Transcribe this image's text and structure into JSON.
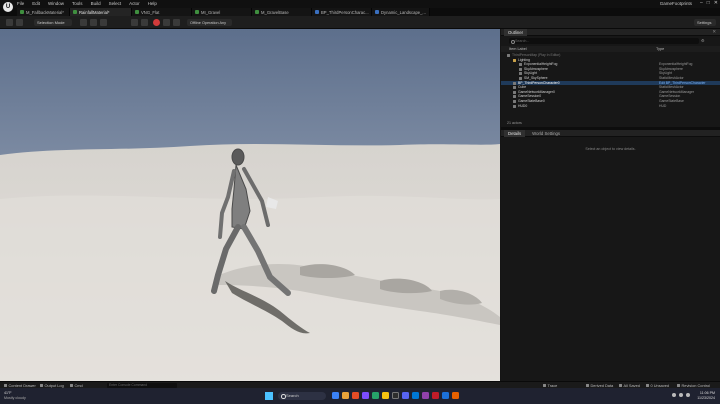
{
  "menubar": {
    "logo": "U",
    "menus": [
      "File",
      "Edit",
      "Window",
      "Tools",
      "Build",
      "Select",
      "Actor",
      "Help"
    ],
    "project": "GameFootprints",
    "window_controls": [
      "–",
      "□",
      "✕"
    ]
  },
  "tabs": [
    {
      "label": "M_FallbackMaterial*",
      "color": "#3f8f3f"
    },
    {
      "label": "RainfallMaterial*",
      "color": "#3f8f3f",
      "active": true
    },
    {
      "label": "VNG_Flat",
      "color": "#3f8f3f"
    },
    {
      "label": "MI_Gravel",
      "color": "#3f8f3f"
    },
    {
      "label": "M_GravelBase",
      "color": "#3f8f3f"
    },
    {
      "label": "BP_ThirdPersonCharac...",
      "color": "#3a6fbf"
    },
    {
      "label": "Dynamic_Landscape_...",
      "color": "#3a6fbf"
    }
  ],
  "toolbar": {
    "mode": "Selection Mode",
    "platforms": "Offline Operation Any",
    "settings": "Settings"
  },
  "outliner": {
    "title": "Outliner",
    "search_placeholder": "Search...",
    "col_label": "Item Label",
    "col_type": "Type",
    "rows": [
      {
        "name": "ThirdPersonMap (Play In Editor)",
        "type": "",
        "indent": 0,
        "kind": "dim"
      },
      {
        "name": "Lighting",
        "type": "",
        "indent": 1,
        "kind": "folder"
      },
      {
        "name": "ExponentialHeightFog",
        "type": "ExponentialHeightFog",
        "indent": 2,
        "kind": "item"
      },
      {
        "name": "SkyAtmosphere",
        "type": "SkyAtmosphere",
        "indent": 2,
        "kind": "item"
      },
      {
        "name": "SkyLight",
        "type": "SkyLight",
        "indent": 2,
        "kind": "item"
      },
      {
        "name": "SM_SkySphere",
        "type": "StaticMeshActor",
        "indent": 2,
        "kind": "item"
      },
      {
        "name": "BP_ThirdPersonCharacter0",
        "type": "Edit BP_ThirdPersonCharacter",
        "indent": 1,
        "kind": "sel"
      },
      {
        "name": "Cube",
        "type": "StaticMeshActor",
        "indent": 1,
        "kind": "item"
      },
      {
        "name": "GameNetworkManager0",
        "type": "GameNetworkManager",
        "indent": 1,
        "kind": "item"
      },
      {
        "name": "GameSession0",
        "type": "GameSession",
        "indent": 1,
        "kind": "item"
      },
      {
        "name": "GameStateBase0",
        "type": "GameStateBase",
        "indent": 1,
        "kind": "item"
      },
      {
        "name": "HUD0",
        "type": "HUD",
        "indent": 1,
        "kind": "item"
      }
    ],
    "count": "21 actors"
  },
  "details": {
    "tab_details": "Details",
    "tab_world": "World Settings",
    "empty_message": "Select an object to view details."
  },
  "bottombar": {
    "content_drawer": "Content Drawer",
    "output_log": "Output Log",
    "cmd": "Cmd",
    "cmd_placeholder": "Enter Console Command",
    "trace": "Trace",
    "derived_data": "Derived Data",
    "all_saved": "All Saved",
    "unsaved": "0 Unsaved",
    "revision_control": "Revision Control"
  },
  "taskbar": {
    "weather_temp": "41°F",
    "weather_desc": "Mostly cloudy",
    "search": "Search",
    "time": "11:06 PM",
    "date": "11/23/2024"
  },
  "colors": {
    "accent_blue": "#3a6fbf",
    "selection": "#1f3a5a",
    "play_green": "#3fbf4a",
    "stop_red": "#d23b3b"
  }
}
